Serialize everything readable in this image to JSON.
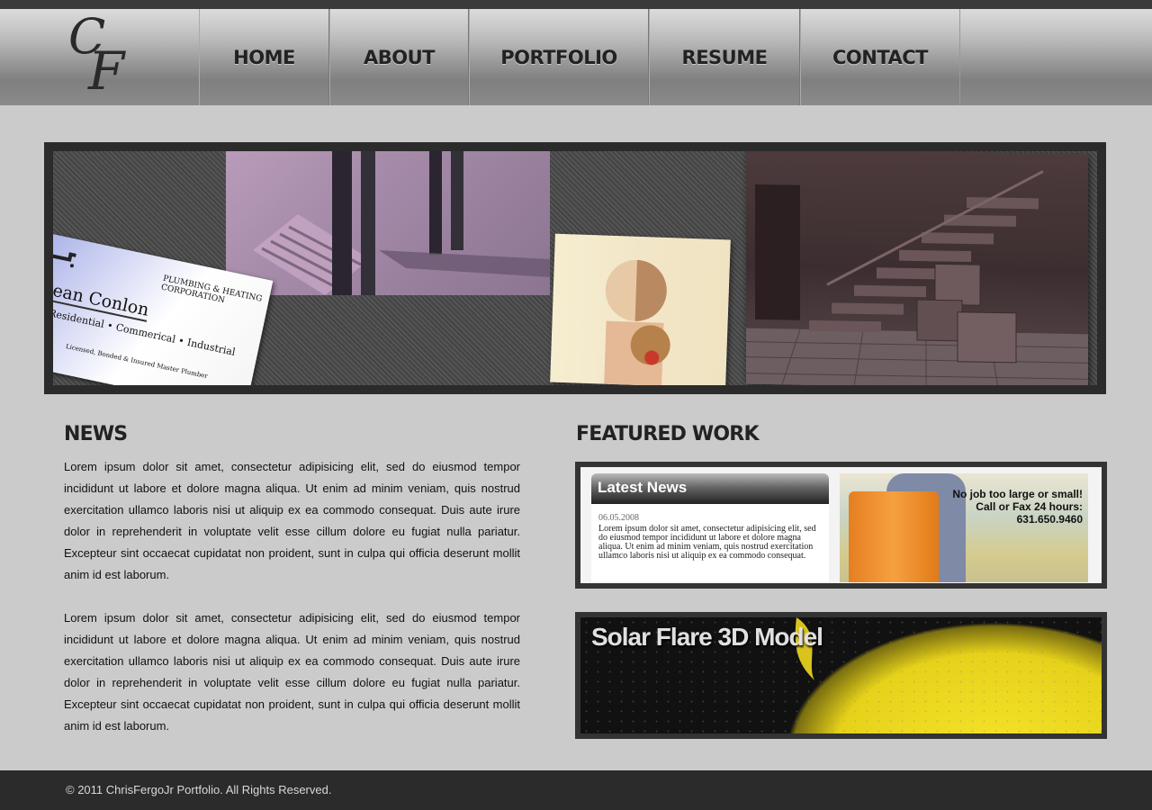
{
  "header": {
    "logo_c": "C",
    "logo_f": "F",
    "nav": [
      {
        "label": "HOME"
      },
      {
        "label": "ABOUT"
      },
      {
        "label": "PORTFOLIO"
      },
      {
        "label": "RESUME"
      },
      {
        "label": "CONTACT"
      }
    ]
  },
  "banner": {
    "card_corp": "PLUMBING & HEATING CORPORATION",
    "card_name": "Sean Conlon",
    "card_sub": "Residential • Commerical • Industrial",
    "card_license": "Licensed, Bonded & Insured Master Plumber"
  },
  "news": {
    "title": "NEWS",
    "paragraphs": [
      "Lorem ipsum dolor sit amet, consectetur adipisicing elit, sed do eiusmod tempor incididunt ut labore et dolore magna aliqua. Ut enim ad minim veniam, quis nostrud exercitation ullamco laboris nisi ut aliquip ex ea commodo consequat. Duis aute irure dolor in reprehenderit in voluptate velit esse cillum dolore eu fugiat nulla pariatur. Excepteur sint occaecat cupidatat non proident, sunt in culpa qui officia deserunt mollit anim id est laborum.",
      "Lorem ipsum dolor sit amet, consectetur adipisicing elit, sed do eiusmod tempor incididunt ut labore et dolore magna aliqua. Ut enim ad minim veniam, quis nostrud exercitation ullamco laboris nisi ut aliquip ex ea commodo consequat. Duis aute irure dolor in reprehenderit in voluptate velit esse cillum dolore eu fugiat nulla pariatur. Excepteur sint occaecat cupidatat non proident, sunt in culpa qui officia deserunt mollit anim id est laborum."
    ]
  },
  "featured": {
    "title": "FEATURED WORK",
    "item1": {
      "tab_label": "Latest News",
      "date": "06.05.2008",
      "text": "Lorem ipsum dolor sit amet, consectetur adipisicing elit, sed do eiusmod tempor incididunt ut labore et dolore magna aliqua. Ut enim ad minim veniam, quis nostrud exercitation ullamco laboris nisi ut aliquip ex ea commodo consequat.",
      "ad_line1": "No job too large or small!",
      "ad_line2": "Call or Fax 24 hours:",
      "ad_phone": "631.650.9460"
    },
    "item2": {
      "title": "Solar Flare 3D Model"
    }
  },
  "footer": {
    "copyright": "© 2011 ChrisFergoJr Portfolio. All Rights Reserved."
  },
  "colors": {
    "background": "#cbcbcb",
    "frame": "#2b2b2b",
    "text": "#222222"
  }
}
